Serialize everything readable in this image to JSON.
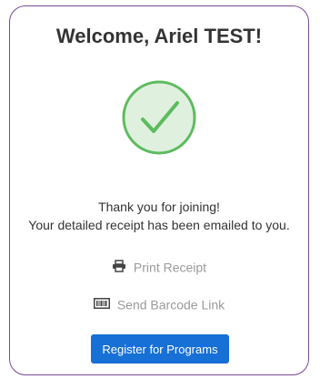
{
  "welcome": {
    "title": "Welcome, Ariel TEST!"
  },
  "success_icon": "check-circle-icon",
  "colors": {
    "card_border": "#7a4a93",
    "success_green": "#5dbb5d",
    "success_fill": "#dff0df",
    "primary_button": "#1670d6",
    "muted_text": "#9a9a9a"
  },
  "message": {
    "line1": "Thank you for joining!",
    "line2": "Your detailed receipt has been emailed to you."
  },
  "actions": {
    "print": {
      "icon": "printer-icon",
      "label": "Print Receipt"
    },
    "barcode": {
      "icon": "barcode-icon",
      "label": "Send Barcode Link"
    }
  },
  "register_button": {
    "label": "Register for Programs"
  }
}
